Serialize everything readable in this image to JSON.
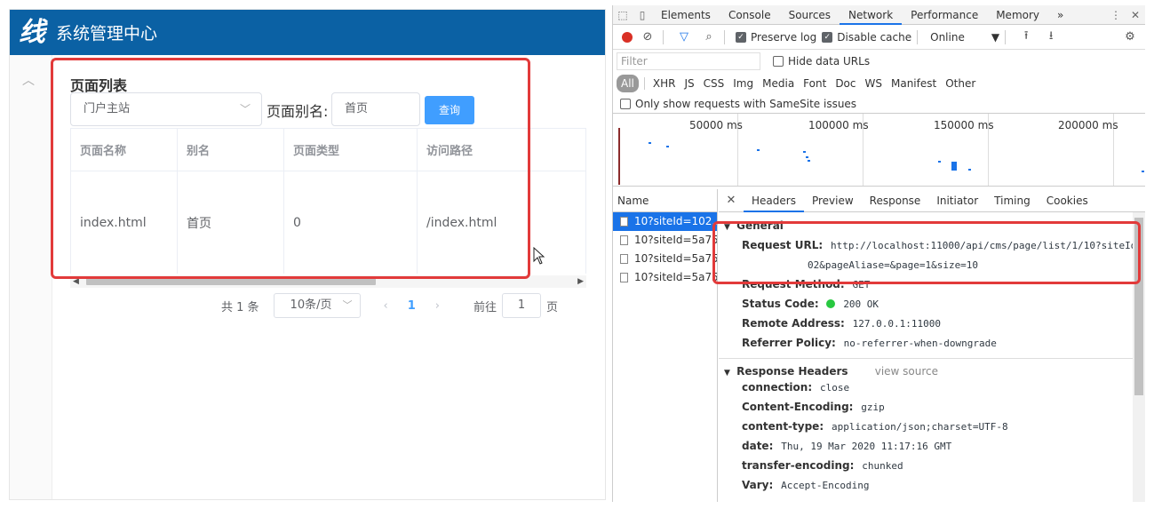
{
  "app": {
    "logo_glyph": "线",
    "title": "系统管理中心",
    "collapse_icon": "chevron-up",
    "page_list_title": "页面列表",
    "site_select": {
      "value": "门户主站"
    },
    "alias": {
      "label": "页面别名:",
      "value": "首页"
    },
    "query_button": "查询",
    "table": {
      "columns": [
        "页面名称",
        "别名",
        "页面类型",
        "访问路径"
      ],
      "rows": [
        [
          "index.html",
          "首页",
          "0",
          "/index.html"
        ]
      ]
    },
    "pager": {
      "total": "共 1 条",
      "page_size": "10条/页",
      "prev": "‹",
      "current": "1",
      "next": "›",
      "goto_label": "前往",
      "goto_value": "1",
      "goto_unit": "页"
    }
  },
  "devtools": {
    "tabs": [
      "Elements",
      "Console",
      "Sources",
      "Network",
      "Performance",
      "Memory"
    ],
    "active_tab": "Network",
    "more_tabs": "»",
    "toolbar": {
      "preserve_log": "Preserve log",
      "disable_cache": "Disable cache",
      "throttle": "Online"
    },
    "filter_placeholder": "Filter",
    "hide_data_urls": "Hide data URLs",
    "types": [
      "All",
      "XHR",
      "JS",
      "CSS",
      "Img",
      "Media",
      "Font",
      "Doc",
      "WS",
      "Manifest",
      "Other"
    ],
    "samesite": "Only show requests with SameSite issues",
    "timeline_labels": [
      "50000 ms",
      "100000 ms",
      "150000 ms",
      "200000 ms"
    ],
    "name_header": "Name",
    "requests": [
      "10?siteId=102...",
      "10?siteId=5a75...",
      "10?siteId=5a75...",
      "10?siteId=5a75..."
    ],
    "detail_tabs": [
      "Headers",
      "Preview",
      "Response",
      "Initiator",
      "Timing",
      "Cookies"
    ],
    "general": {
      "title": "General",
      "request_url_key": "Request URL:",
      "request_url_line1": "http://localhost:11000/api/cms/page/list/1/10?siteId=1",
      "request_url_line2": "02&pageAliase=&page=1&size=10",
      "method_key": "Request Method:",
      "method_val": "GET",
      "status_key": "Status Code:",
      "status_val": "200 OK",
      "remote_key": "Remote Address:",
      "remote_val": "127.0.0.1:11000",
      "referrer_key": "Referrer Policy:",
      "referrer_val": "no-referrer-when-downgrade"
    },
    "response_headers": {
      "title": "Response Headers",
      "view_source": "view source",
      "items": [
        {
          "k": "connection:",
          "v": "close"
        },
        {
          "k": "Content-Encoding:",
          "v": "gzip"
        },
        {
          "k": "content-type:",
          "v": "application/json;charset=UTF-8"
        },
        {
          "k": "date:",
          "v": "Thu, 19 Mar 2020 11:17:16 GMT"
        },
        {
          "k": "transfer-encoding:",
          "v": "chunked"
        },
        {
          "k": "Vary:",
          "v": "Accept-Encoding"
        }
      ]
    }
  }
}
